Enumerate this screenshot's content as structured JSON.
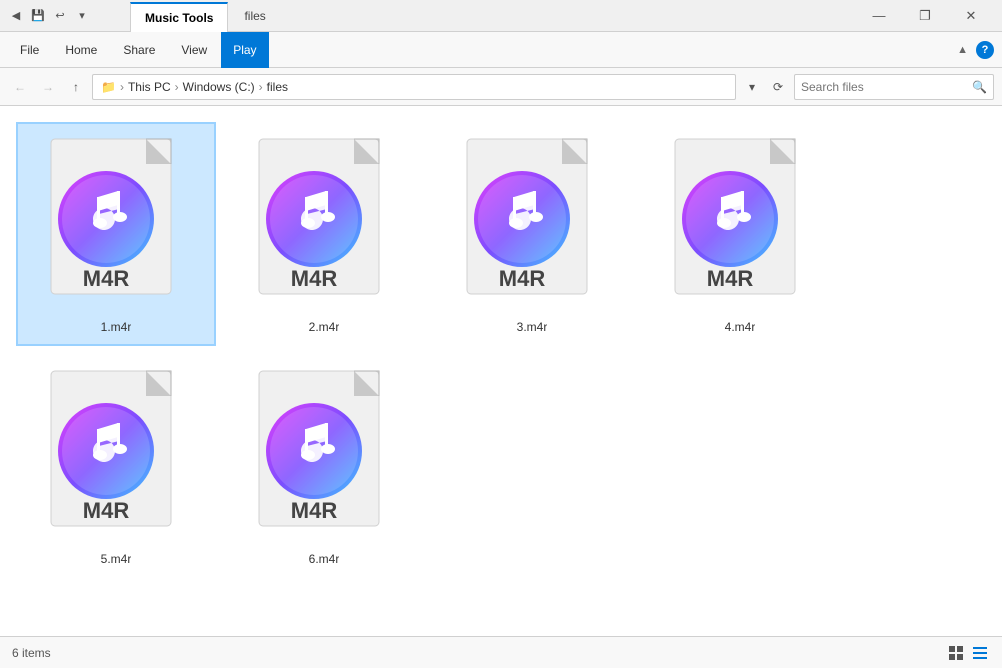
{
  "titlebar": {
    "tab_music_tools": "Music Tools",
    "tab_title": "files",
    "win_minimize": "—",
    "win_restore": "❐",
    "win_close": "✕"
  },
  "ribbon": {
    "tabs": [
      {
        "id": "file",
        "label": "File",
        "active": false
      },
      {
        "id": "home",
        "label": "Home",
        "active": false
      },
      {
        "id": "share",
        "label": "Share",
        "active": false
      },
      {
        "id": "view",
        "label": "View",
        "active": false
      },
      {
        "id": "play",
        "label": "Play",
        "active": true
      }
    ]
  },
  "addressbar": {
    "back_label": "←",
    "forward_label": "→",
    "up_label": "↑",
    "path": [
      {
        "label": "This PC"
      },
      {
        "label": "Windows (C:)"
      },
      {
        "label": "files"
      }
    ],
    "refresh_label": "⟳",
    "search_placeholder": "Search files"
  },
  "files": [
    {
      "id": 1,
      "label": "1.m4r",
      "type_label": "M4R",
      "selected": true
    },
    {
      "id": 2,
      "label": "2.m4r",
      "type_label": "M4R",
      "selected": false
    },
    {
      "id": 3,
      "label": "3.m4r",
      "type_label": "M4R",
      "selected": false
    },
    {
      "id": 4,
      "label": "4.m4r",
      "type_label": "M4R",
      "selected": false
    },
    {
      "id": 5,
      "label": "5.m4r",
      "type_label": "M4R",
      "selected": false
    },
    {
      "id": 6,
      "label": "6.m4r",
      "type_label": "M4R",
      "selected": false
    }
  ],
  "statusbar": {
    "item_count": "6 items"
  },
  "colors": {
    "selection_border": "#0078d7",
    "accent": "#0078d7"
  }
}
